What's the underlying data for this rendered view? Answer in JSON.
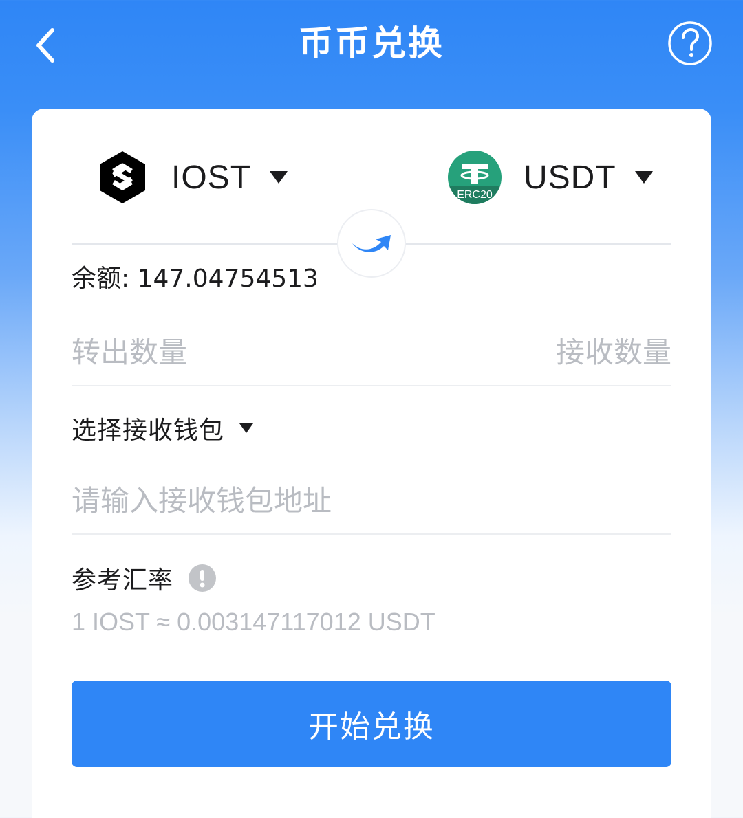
{
  "header": {
    "title": "币币兑换",
    "back_icon": "chevron-left-icon",
    "help_icon": "question-circle-icon"
  },
  "swap": {
    "from_token": {
      "symbol": "IOST",
      "logo": "iost-logo"
    },
    "to_token": {
      "symbol": "USDT",
      "logo": "usdt-erc20-logo",
      "network_badge": "ERC20"
    },
    "swap_icon": "curved-arrow-right-icon",
    "balance_label": "余额: 147.04754513",
    "send_amount_placeholder": "转出数量",
    "receive_amount_placeholder": "接收数量"
  },
  "wallet": {
    "select_label": "选择接收钱包",
    "address_placeholder": "请输入接收钱包地址"
  },
  "rate": {
    "label": "参考汇率",
    "info_icon": "exclamation-circle-icon",
    "value": "1 IOST ≈ 0.003147117012 USDT"
  },
  "actions": {
    "submit_label": "开始兑换"
  },
  "colors": {
    "primary": "#2f86f6",
    "usdt_green": "#26a17b",
    "placeholder": "#b9bcc2",
    "text": "#1c1c1e"
  }
}
